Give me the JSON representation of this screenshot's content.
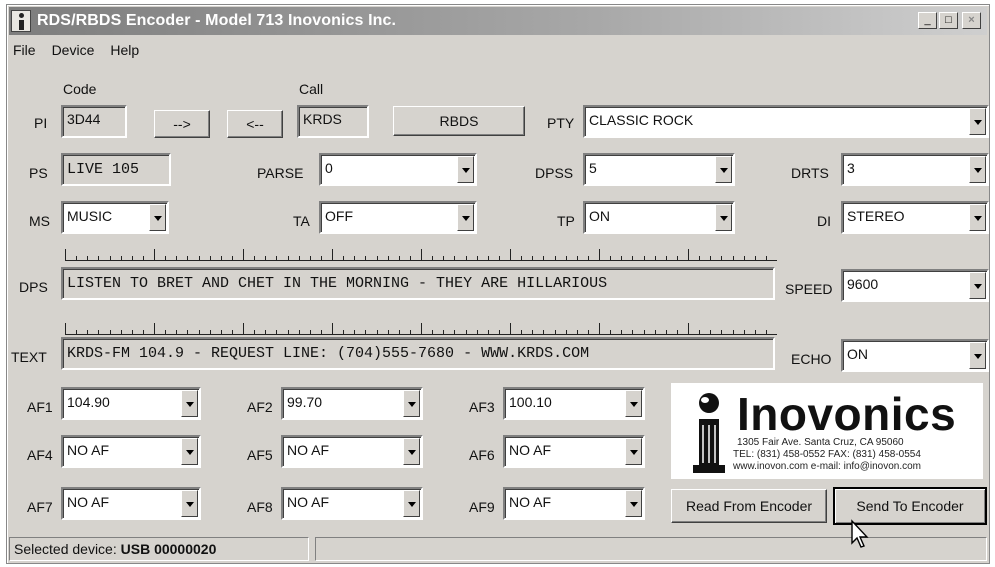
{
  "window": {
    "title": "RDS/RBDS Encoder - Model 713 Inovonics Inc."
  },
  "menu": [
    "File",
    "Device",
    "Help"
  ],
  "pi": {
    "label": "PI",
    "code_label": "Code",
    "code": "3D44",
    "arrow_right": "-->",
    "arrow_left": "<--",
    "call_label": "Call",
    "call": "KRDS",
    "mode_button": "RBDS"
  },
  "pty": {
    "label": "PTY",
    "value": "CLASSIC ROCK"
  },
  "ps": {
    "label": "PS",
    "value": "LIVE 105"
  },
  "parse": {
    "label": "PARSE",
    "value": "0"
  },
  "dpss": {
    "label": "DPSS",
    "value": "5"
  },
  "drts": {
    "label": "DRTS",
    "value": "3"
  },
  "ms": {
    "label": "MS",
    "value": "MUSIC"
  },
  "ta": {
    "label": "TA",
    "value": "OFF"
  },
  "tp": {
    "label": "TP",
    "value": "ON"
  },
  "di": {
    "label": "DI",
    "value": "STEREO"
  },
  "dps": {
    "label": "DPS",
    "value": "LISTEN TO BRET AND CHET IN THE MORNING - THEY ARE HILLARIOUS"
  },
  "speed": {
    "label": "SPEED",
    "value": "9600"
  },
  "text": {
    "label": "TEXT",
    "value": "KRDS-FM 104.9 - REQUEST LINE: (704)555-7680 - WWW.KRDS.COM"
  },
  "echo": {
    "label": "ECHO",
    "value": "ON"
  },
  "af": [
    {
      "label": "AF1",
      "value": "104.90"
    },
    {
      "label": "AF2",
      "value": "99.70"
    },
    {
      "label": "AF3",
      "value": "100.10"
    },
    {
      "label": "AF4",
      "value": "NO AF"
    },
    {
      "label": "AF5",
      "value": "NO AF"
    },
    {
      "label": "AF6",
      "value": "NO AF"
    },
    {
      "label": "AF7",
      "value": "NO AF"
    },
    {
      "label": "AF8",
      "value": "NO AF"
    },
    {
      "label": "AF9",
      "value": "NO AF"
    }
  ],
  "logo": {
    "name": "Inovonics",
    "address": "1305 Fair Ave. Santa Cruz, CA 95060",
    "phone": "TEL: (831) 458-0552 FAX: (831) 458-0554",
    "web": "www.inovon.com e-mail: info@inovon.com"
  },
  "buttons": {
    "read": "Read From Encoder",
    "send": "Send To Encoder"
  },
  "status": {
    "prefix": "Selected device: ",
    "device": "USB 00000020"
  },
  "icons": {
    "app": "inovonics-app-icon",
    "cursor": "mouse-pointer-icon"
  }
}
